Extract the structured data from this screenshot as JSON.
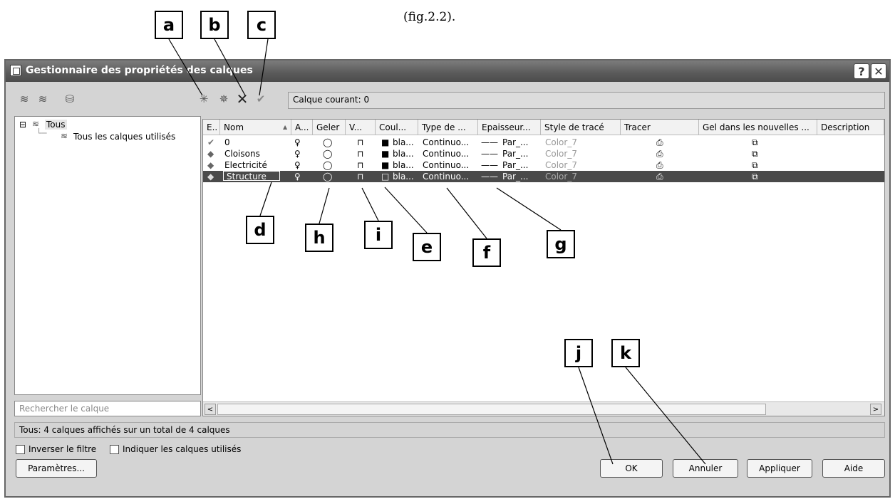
{
  "caption": "(fig.2.2).",
  "callouts": [
    "a",
    "b",
    "c",
    "d",
    "h",
    "i",
    "e",
    "f",
    "g",
    "j",
    "k"
  ],
  "window": {
    "title": "Gestionnaire des propriétés des calques",
    "help_btn": "?",
    "close_btn": "✕"
  },
  "current_layer": "Calque courant: 0",
  "tree": {
    "root": "Tous",
    "child": "Tous les calques utilisés"
  },
  "search_placeholder": "Rechercher le calque",
  "columns": [
    "E..",
    "Nom",
    "A...",
    "Geler",
    "V...",
    "Coul...",
    "Type de ...",
    "Epaisseur...",
    "Style de tracé",
    "Tracer",
    "Gel dans les nouvelles ...",
    "Description"
  ],
  "rows": [
    {
      "name": "0",
      "color": "bla...",
      "linetype": "Continuo...",
      "lineweight": "Par_...",
      "plotstyle": "Color_7"
    },
    {
      "name": "Cloisons",
      "color": "bla...",
      "linetype": "Continuo...",
      "lineweight": "Par_...",
      "plotstyle": "Color_7"
    },
    {
      "name": "Electricité",
      "color": "bla...",
      "linetype": "Continuo...",
      "lineweight": "Par_...",
      "plotstyle": "Color_7"
    },
    {
      "name": "Structure",
      "color": "bla...",
      "linetype": "Continuo...",
      "lineweight": "Par_...",
      "plotstyle": "Color_7"
    }
  ],
  "status": "Tous: 4 calques affichés sur un total de 4 calques",
  "invert_filter": "Inverser le filtre",
  "show_used": "Indiquer les calques utilisés",
  "buttons": {
    "settings": "Paramètres...",
    "ok": "OK",
    "cancel": "Annuler",
    "apply": "Appliquer",
    "help": "Aide"
  },
  "scroll": {
    "left": "<",
    "right": ">"
  }
}
